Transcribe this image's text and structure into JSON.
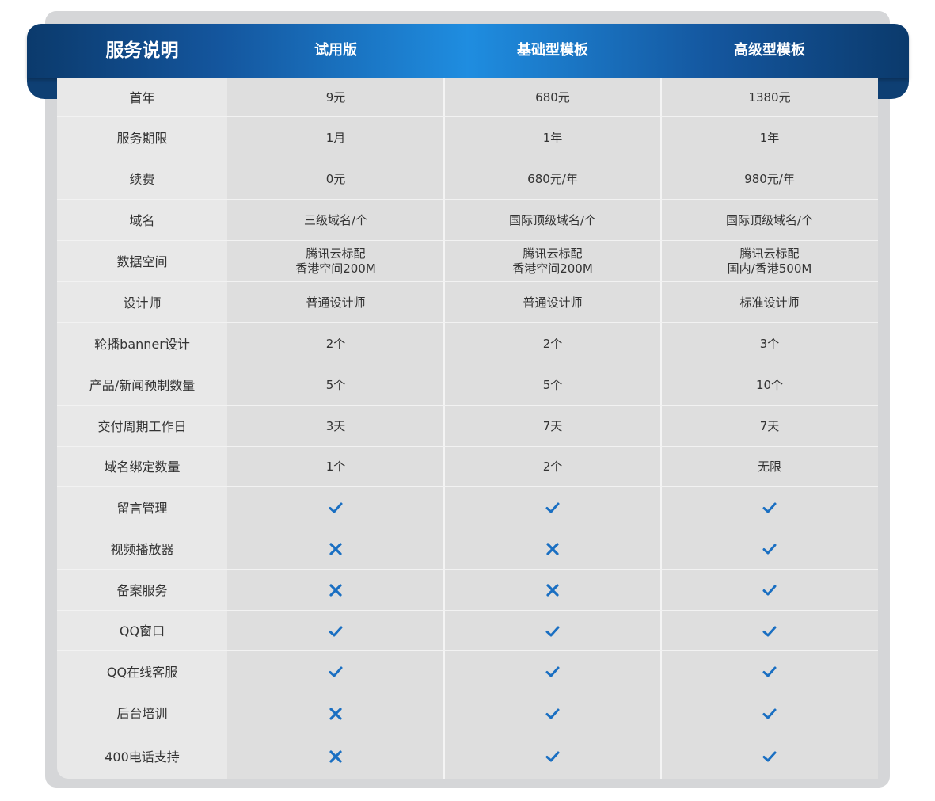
{
  "header": {
    "title": "服务说明",
    "plans": [
      "试用版",
      "基础型模板",
      "高级型模板"
    ]
  },
  "rows": [
    {
      "label": "首年",
      "values": [
        "9元",
        "680元",
        "1380元"
      ]
    },
    {
      "label": "服务期限",
      "values": [
        "1月",
        "1年",
        "1年"
      ]
    },
    {
      "label": "续费",
      "values": [
        "0元",
        "680元/年",
        "980元/年"
      ]
    },
    {
      "label": "域名",
      "values": [
        "三级域名/个",
        "国际顶级域名/个",
        "国际顶级域名/个"
      ]
    },
    {
      "label": "数据空间",
      "values": [
        "腾讯云标配\n香港空间200M",
        "腾讯云标配\n香港空间200M",
        "腾讯云标配\n国内/香港500M"
      ]
    },
    {
      "label": "设计师",
      "values": [
        "普通设计师",
        "普通设计师",
        "标准设计师"
      ]
    },
    {
      "label": "轮播banner设计",
      "values": [
        "2个",
        "2个",
        "3个"
      ]
    },
    {
      "label": "产品/新闻预制数量",
      "values": [
        "5个",
        "5个",
        "10个"
      ]
    },
    {
      "label": "交付周期工作日",
      "values": [
        "3天",
        "7天",
        "7天"
      ]
    },
    {
      "label": "域名绑定数量",
      "values": [
        "1个",
        "2个",
        "无限"
      ]
    },
    {
      "label": "留言管理",
      "values": [
        "check",
        "check",
        "check"
      ]
    },
    {
      "label": "视频播放器",
      "values": [
        "cross",
        "cross",
        "check"
      ]
    },
    {
      "label": "备案服务",
      "values": [
        "cross",
        "cross",
        "check"
      ]
    },
    {
      "label": "QQ窗口",
      "values": [
        "check",
        "check",
        "check"
      ]
    },
    {
      "label": "QQ在线客服",
      "values": [
        "check",
        "check",
        "check"
      ]
    },
    {
      "label": "后台培训",
      "values": [
        "cross",
        "check",
        "check"
      ]
    },
    {
      "label": "400电话支持",
      "values": [
        "cross",
        "check",
        "check"
      ]
    }
  ],
  "colors": {
    "accent": "#1a6fc2",
    "header_dark": "#0b3a6c",
    "header_light": "#1f8de0"
  }
}
